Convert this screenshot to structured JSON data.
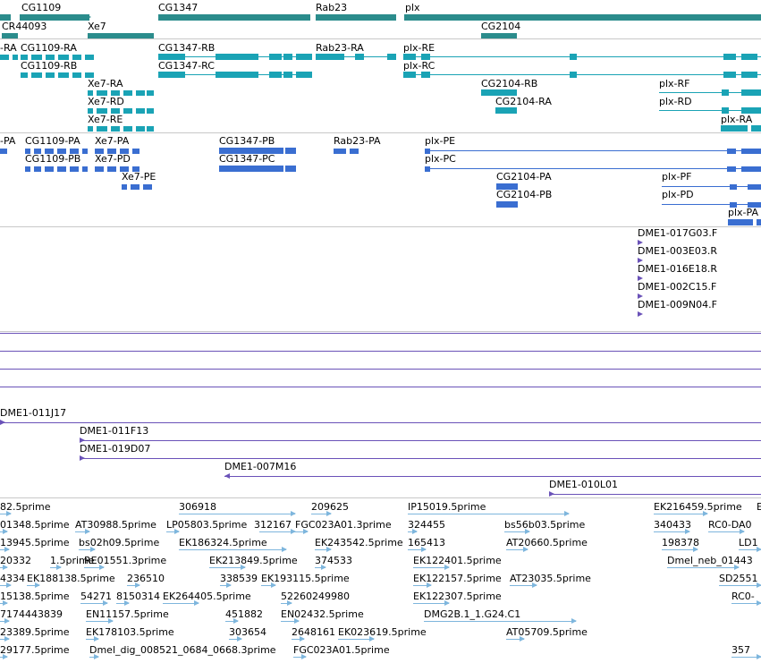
{
  "colors": {
    "gene": "#2b8c8c",
    "transcript": "#1aa3b5",
    "protein": "#3a6ed1",
    "clone": "#6a52b8",
    "est": "#7eb6dd",
    "separator": "#c8c8c8"
  },
  "genes": [
    "CG1109",
    "CR44093",
    "Xe7",
    "CG1347",
    "Rab23",
    "plx",
    "CG2104"
  ],
  "transcripts": [
    "-RA",
    "CG1109-RA",
    "CG1109-RB",
    "CG1347-RB",
    "CG1347-RC",
    "Rab23-RA",
    "plx-RE",
    "plx-RC",
    "Xe7-RA",
    "Xe7-RD",
    "Xe7-RE",
    "CG2104-RB",
    "CG2104-RA",
    "plx-RF",
    "plx-RD",
    "plx-RA"
  ],
  "proteins": [
    "-PA",
    "CG1109-PA",
    "CG1109-PB",
    "Xe7-PA",
    "Xe7-PD",
    "Xe7-PE",
    "CG1347-PB",
    "CG1347-PC",
    "Rab23-PA",
    "plx-PE",
    "plx-PC",
    "CG2104-PA",
    "CG2104-PB",
    "plx-PF",
    "plx-PD",
    "plx-PA"
  ],
  "clones": [
    "DME1-017G03.F",
    "DME1-003E03.R",
    "DME1-016E18.R",
    "DME1-002C15.F",
    "DME1-009N04.F",
    "DME1-011J17",
    "DME1-011F13",
    "DME1-019D07",
    "DME1-007M16",
    "DME1-010L01"
  ],
  "ests": [
    "82.5prime",
    "306918",
    "209625",
    "IP15019.5prime",
    "EK216459.5prime",
    "E",
    "01348.5prime",
    "AT30988.5prime",
    "LP05803.5prime",
    "312167",
    "FGC023A01.3prime",
    "324455",
    "bs56b03.5prime",
    "340433",
    "RC0-DA0",
    "13945.5prime",
    "bs02h09.5prime",
    "EK186324.5prime",
    "EK243542.5prime",
    "165413",
    "AT20660.5prime",
    "198378",
    "LD1",
    "20332",
    "1.5prime",
    "RE01551.3prime",
    "EK213849.5prime",
    "374533",
    "EK122401.5prime",
    "Dmel_neb_01443",
    "4334",
    "EK188138.5prime",
    "236510",
    "338539",
    "EK193115.5prime",
    "EK122157.5prime",
    "AT23035.5prime",
    "SD2551",
    "15138.5prime",
    "54271",
    "8150314",
    "EK264405.5prime",
    "52260249980",
    "EK122307.5prime",
    "RC0-",
    "7174443839",
    "EN11157.5prime",
    "451882",
    "EN02432.5prime",
    "DMG2B.1_1.G24.C1",
    "23389.5prime",
    "EK178103.5prime",
    "303654",
    "2648161",
    "EK023619.5prime",
    "AT05709.5prime",
    "29177.5prime",
    "Dmel_dig_008521_0684_0668.3prime",
    "FGC023A01.5prime",
    "357"
  ]
}
